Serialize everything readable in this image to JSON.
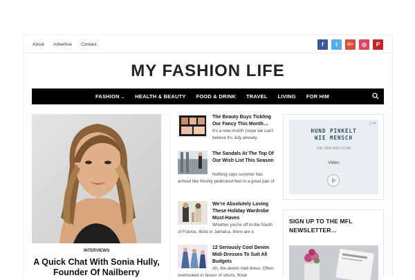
{
  "topbar": {
    "links": [
      "About",
      "Advertise",
      "Contact"
    ],
    "social": [
      {
        "icon": "facebook-icon",
        "glyph": "f",
        "color": "#3b5998"
      },
      {
        "icon": "twitter-icon",
        "glyph": "t",
        "color": "#55acee"
      },
      {
        "icon": "google-plus-icon",
        "glyph": "G+",
        "color": "#dd4b39"
      },
      {
        "icon": "instagram-icon",
        "glyph": "◎",
        "color": "#e4405f"
      },
      {
        "icon": "pinterest-icon",
        "glyph": "P",
        "color": "#cb2027"
      }
    ]
  },
  "site": {
    "title": "MY FASHION LIFE"
  },
  "nav": {
    "items": [
      "FASHION",
      "HEALTH & BEAUTY",
      "FOOD & DRINK",
      "TRAVEL",
      "LIVING",
      "FOR HIM"
    ],
    "dropdown_glyph": "⌄",
    "search_icon": "search-icon",
    "background": "#000000"
  },
  "featured": {
    "category": "INTERVIEWS",
    "title": "A Quick Chat With Sonia Hully, Founder Of Nailberry"
  },
  "articles": [
    {
      "title": "The Beauty Buys Tickling Our Fancy This Month…",
      "excerpt": "It's a new month (nope we can't believe it's July already"
    },
    {
      "title": "The Sandals At The Top Of Our Wish List This Season",
      "excerpt": "Nothing says summer has arrived like freshly pedicured feet in a great pair of"
    },
    {
      "title": "We're Absolutely Loving These Holiday Wardrobe Must-Haves",
      "excerpt": "Whether you're off to the South of France, Ibiza or Jamaica, there are a"
    },
    {
      "title": "12 Seriously Cool Denim Midi-Dresses To Suit All Budgets",
      "excerpt": "Ah, the denim midi dress. Often overlooked in favour of shorts, floral"
    }
  ],
  "ad": {
    "headline_line1": "HUND PINKELT",
    "headline_line2": "WIE MENSCH",
    "url": "DIE-TIER-WELT.COM",
    "video_label": "Video",
    "close_glyph": "▷✕",
    "accent": "#2f4a66"
  },
  "newsletter": {
    "title": "SIGN UP TO THE MFL NEWSLETTER…"
  }
}
